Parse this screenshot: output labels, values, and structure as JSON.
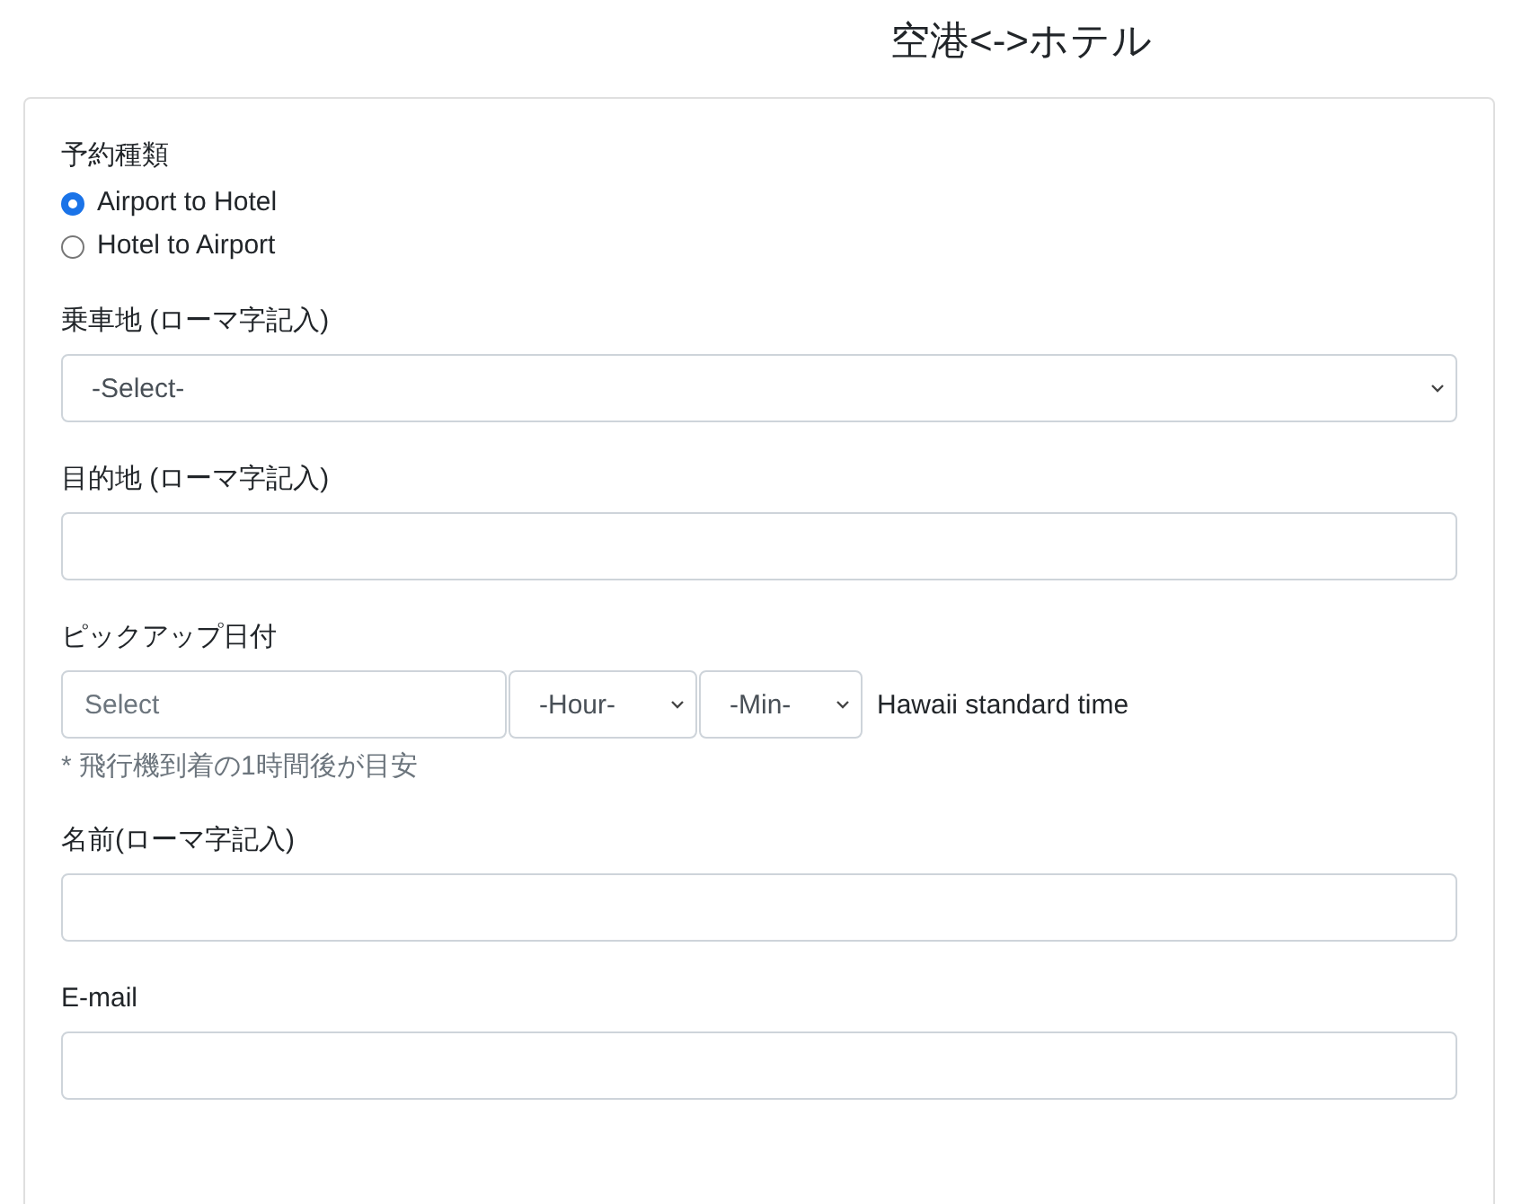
{
  "title": "空港<->ホテル",
  "reservation_type": {
    "label": "予約種類",
    "options": [
      {
        "label": "Airport to Hotel",
        "selected": true
      },
      {
        "label": "Hotel to Airport",
        "selected": false
      }
    ]
  },
  "fields": [
    {
      "kind": "select",
      "label": "乗車地 (ローマ字記入)",
      "value": "-Select-"
    },
    {
      "kind": "text",
      "label": "目的地 (ローマ字記入)"
    },
    {
      "kind": "datetime",
      "label": "ピックアップ日付",
      "placeholder": "Select",
      "hour": "-Hour-",
      "minute": "-Min-",
      "timezone": "Hawaii standard time",
      "hint": "* 飛行機到着の1時間後が目安"
    },
    {
      "kind": "text",
      "label": "名前(ローマ字記入)"
    },
    {
      "kind": "text",
      "label": "E-mail"
    }
  ]
}
